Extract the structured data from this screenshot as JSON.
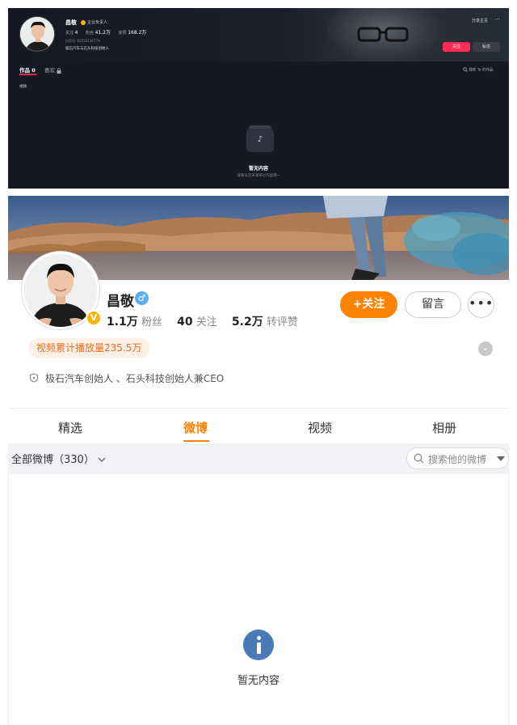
{
  "douyin": {
    "name": "昌敬",
    "verified_label": "企业负责人",
    "stats": [
      {
        "label": "关注",
        "value": "4"
      },
      {
        "label": "粉丝",
        "value": "41.2万"
      },
      {
        "label": "获赞",
        "value": "168.2万"
      }
    ],
    "id_text": "抖音号: 63550130779",
    "bio": "极石汽车与石头科技创始人",
    "share_label": "分享主页",
    "more_label": "···",
    "follow_label": "关注",
    "message_label": "私信",
    "tab_works": "作品 0",
    "tab_likes": "喜欢",
    "search_label": "搜索 Ta 的作品",
    "sub_tab": "视频",
    "empty_title": "暂无内容",
    "empty_sub": "该账号还未发布过作品哦~",
    "accent_color": "#fe2c55"
  },
  "weibo": {
    "name": "昌敬",
    "gender_icon": "♂",
    "verified_badge": "V",
    "stats": {
      "fans_value": "1.1万",
      "fans_label": "粉丝",
      "following_value": "40",
      "following_label": "关注",
      "reposts_value": "5.2万",
      "reposts_label": "转评赞"
    },
    "follow_label": "+关注",
    "leave_msg_label": "留言",
    "more_label": "•••",
    "play_count": "视频累计播放量235.5万",
    "bio": "极石汽车创始人 、石头科技创始人兼CEO",
    "tabs": [
      "精选",
      "微博",
      "视频",
      "相册"
    ],
    "active_tab": "微博",
    "all_weibo": "全部微博（330）",
    "search_placeholder": "搜索他的微博",
    "empty_text": "暂无内容",
    "accent_color": "#ff8200"
  }
}
